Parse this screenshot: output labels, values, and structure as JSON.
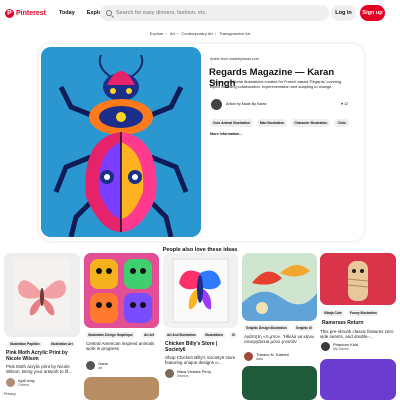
{
  "header": {
    "brand": "Pinterest",
    "nav": [
      "Today",
      "Explore"
    ],
    "search_placeholder": "Search for easy dinners, fashion, etc.",
    "login": "Log in",
    "signup": "Sign up"
  },
  "breadcrumb": [
    "Explore",
    "Art",
    "Contemporary Art",
    "Transgressive Art"
  ],
  "pin": {
    "article_from": "Article from madebykaran.com",
    "title": "Regards Magazine — Karan Singh",
    "description": "A series of editorial illustrations created for French-based 'Regards' covering topics including collaboration, experimentation and adapting to change.",
    "author": "Article by Made By Karan",
    "likes": "12",
    "tags": [
      "Cute Animal Illustration",
      "Man Illustration",
      "Character Illustration",
      "Chris"
    ],
    "more_info": "More information..."
  },
  "section_title": "People also love these ideas",
  "col1": {
    "labels": [
      "Illustration Papillon",
      "Illustration Art"
    ],
    "title": "Pink Moth Acrylic Print by Nicole Wilson",
    "desc": "Pink Moth acrylic print by Nicole Wilson. Bring your artwork to lif...",
    "user": "April may",
    "user_sub": "Others"
  },
  "col2": {
    "labels": [
      "Illustration Design Graphique",
      "Art Art"
    ],
    "desc": "Central American inspired animals work in progress",
    "user": "Garia",
    "user_sub": "art"
  },
  "col3": {
    "labels": [
      "Art And Illustration",
      "Illustrations",
      "Ill"
    ],
    "title": "Chicken Billy's Store | Society6",
    "desc": "Shop Chicken Billy's Society6 store featuring unique designs o...",
    "user": "Nitza Victoria Perry",
    "user_sub": "Insects"
  },
  "col4": {
    "labels": [
      "Graphic Design Illustration",
      "Graphic Ill"
    ],
    "desc": "Αγάπητη «Λ.μπο». 'Ηθελα να κάνω συνεργάσεια μόνο μ'αυτόν",
    "user": "Theano N. Katerizi",
    "user_sub": "data"
  },
  "col5": {
    "labels": [
      "Gibaja Cute",
      "Funny Illustration"
    ],
    "title": "Ramerses Return",
    "desc": "This pre-shrunk classic features zero side seams, and double-...",
    "user": "Phantom Kidd",
    "user_sub": "My Saves"
  },
  "footer": {
    "privacy": "Privacy"
  },
  "colors": {
    "brand": "#e60023",
    "beetle_bg": "#1d95c9"
  }
}
